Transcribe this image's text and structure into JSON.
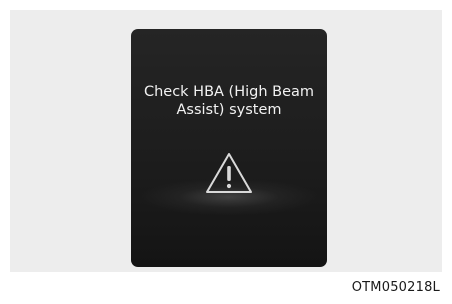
{
  "display": {
    "message_line1": "Check HBA (High Beam",
    "message_line2": "Assist) system",
    "icon": "warning-triangle-icon"
  },
  "figure_code": "OTM050218L",
  "colors": {
    "display_background": "#1c1c1c",
    "message_text": "#f2f2f2",
    "panel_background": "#ededed"
  }
}
